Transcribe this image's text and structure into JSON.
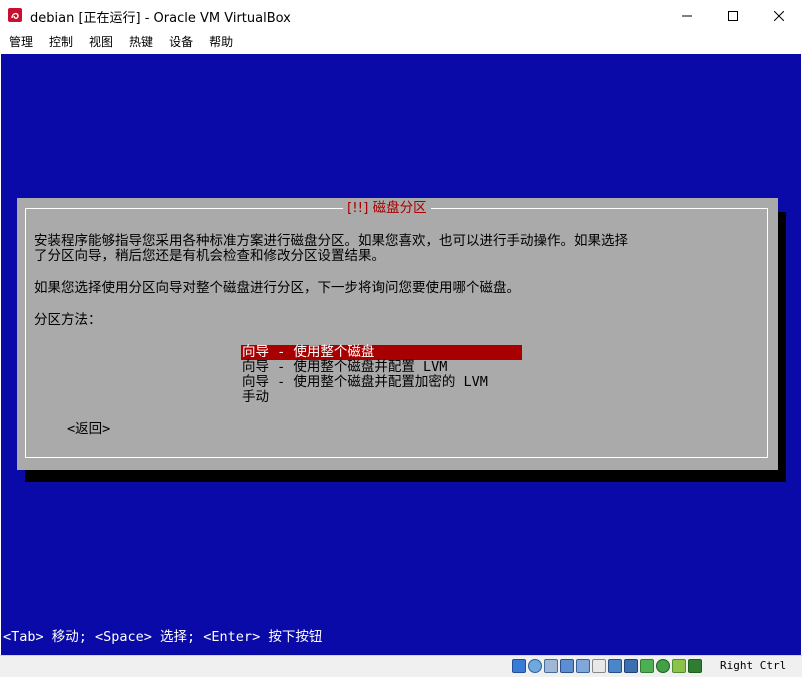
{
  "window": {
    "title": "debian [正在运行] - Oracle VM VirtualBox"
  },
  "menu": {
    "items": [
      "管理",
      "控制",
      "视图",
      "热键",
      "设备",
      "帮助"
    ]
  },
  "installer": {
    "dialog_title": "[!!] 磁盘分区",
    "paragraph1_line1": "安装程序能够指导您采用各种标准方案进行磁盘分区。如果您喜欢，也可以进行手动操作。如果选择",
    "paragraph1_line2": "了分区向导，稍后您还是有机会检查和修改分区设置结果。",
    "paragraph2": "如果您选择使用分区向导对整个磁盘进行分区，下一步将询问您要使用哪个磁盘。",
    "method_label": "分区方法：",
    "options": [
      "向导 - 使用整个磁盘",
      "向导 - 使用整个磁盘并配置 LVM",
      "向导 - 使用整个磁盘并配置加密的 LVM",
      "手动"
    ],
    "selected_option": 0,
    "back_button": "<返回>",
    "hint": "<Tab> 移动; <Space> 选择; <Enter> 按下按钮"
  },
  "statusbar": {
    "icons": [
      "hard-disk-icon",
      "optical-drive-icon",
      "audio-icon",
      "network-icon",
      "usb-icon",
      "shared-folders-icon",
      "display-icon",
      "video-capture-icon",
      "mouse-integration-icon",
      "cpu-icon",
      "keyboard-capture-icon",
      "arrow-down-icon"
    ],
    "host_key": "Right Ctrl"
  },
  "colors": {
    "vm_background": "#0a0aa8",
    "dialog_background": "#aaaaaa",
    "selection": "#a80000"
  }
}
